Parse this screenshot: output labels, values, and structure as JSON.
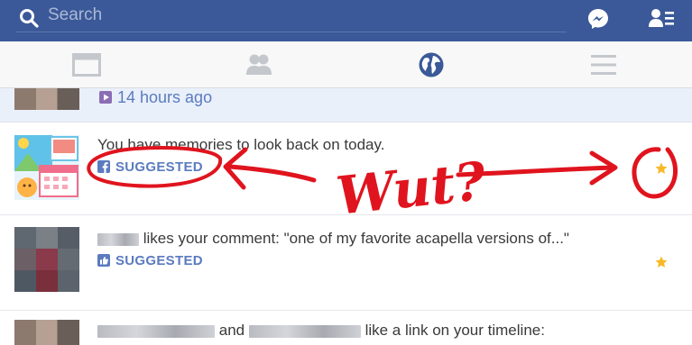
{
  "search": {
    "placeholder": "Search"
  },
  "tabs": [
    {
      "name": "news-feed"
    },
    {
      "name": "friend-requests"
    },
    {
      "name": "notifications"
    },
    {
      "name": "more"
    }
  ],
  "notifications": [
    {
      "time": "14 hours ago"
    },
    {
      "text": "You have memories to look back on today.",
      "tag": "SUGGESTED"
    },
    {
      "text_end": "likes your comment: \"one of my favorite acapella versions of...\"",
      "tag": "SUGGESTED"
    },
    {
      "conjunction": "and",
      "text_end": "like a link on your timeline:"
    }
  ],
  "annotation": {
    "text": "Wut?"
  },
  "colors": {
    "brand": "#3b5998",
    "link": "#5b7bbf",
    "star": "#f7b928",
    "marker": "#e0141e"
  }
}
